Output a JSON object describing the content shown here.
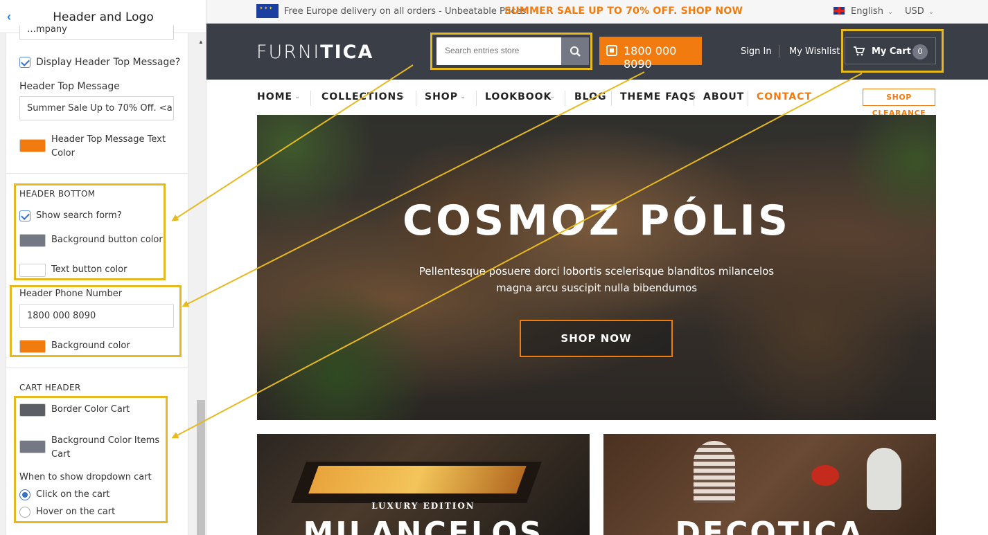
{
  "panel": {
    "title": "Header and Logo",
    "partial_field": "…mpany",
    "display_top_message_label": "Display Header Top Message?",
    "top_message_label": "Header Top Message",
    "top_message_value": "Summer Sale Up to 70% Off. <a",
    "top_message_color_label": "Header Top Message Text Color",
    "top_message_color": "#f27b0f",
    "header_bottom": {
      "title": "HEADER BOTTOM",
      "show_search_label": "Show search form?",
      "bg_button_label": "Background button color",
      "bg_button_color": "#747884",
      "text_button_label": "Text button color",
      "text_button_color": "#ffffff"
    },
    "phone": {
      "label": "Header Phone Number",
      "value": "1800 000 8090",
      "bg_label": "Background color",
      "bg_color": "#f27b0f"
    },
    "cart_header": {
      "title": "CART HEADER",
      "border_label": "Border Color Cart",
      "border_color": "#5c5e66",
      "items_label": "Background Color Items Cart",
      "items_color": "#747884",
      "dropdown_label": "When to show dropdown cart",
      "options": [
        "Click on the cart",
        "Hover on the cart"
      ],
      "selected": "Click on the cart"
    }
  },
  "preview": {
    "topbar": {
      "message": "Free Europe delivery on all orders - Unbeatable Prices",
      "sale": "SUMMER SALE UP TO 70% OFF. SHOP NOW",
      "language": "English",
      "currency": "USD"
    },
    "header": {
      "logo_light": "FURNI",
      "logo_bold": "TICA",
      "search_placeholder": "Search entries store",
      "phone": "1800 000 8090",
      "sign_in": "Sign In",
      "wishlist": "My Wishlist",
      "cart_label": "My Cart",
      "cart_count": "0"
    },
    "nav": {
      "items": [
        "HOME",
        "COLLECTIONS",
        "SHOP",
        "LOOKBOOK",
        "BLOG",
        "THEME FAQS",
        "ABOUT",
        "CONTACT"
      ],
      "clearance": "SHOP CLEARANCE"
    },
    "hero": {
      "title": "COSMOZ PÓLIS",
      "subtitle_line1": "Pellentesque posuere dorci lobortis scelerisque blanditos milancelos",
      "subtitle_line2": "magna arcu suscipit nulla bibendumos",
      "button": "SHOP NOW"
    },
    "promos": [
      {
        "kicker": "LUXURY EDITION",
        "title": "MILANCELOS"
      },
      {
        "kicker": "",
        "title": "DECOTICA"
      }
    ]
  },
  "colors": {
    "accent": "#f27b0f",
    "highlight": "#e6b91e",
    "header_bg": "#3a3e47"
  }
}
